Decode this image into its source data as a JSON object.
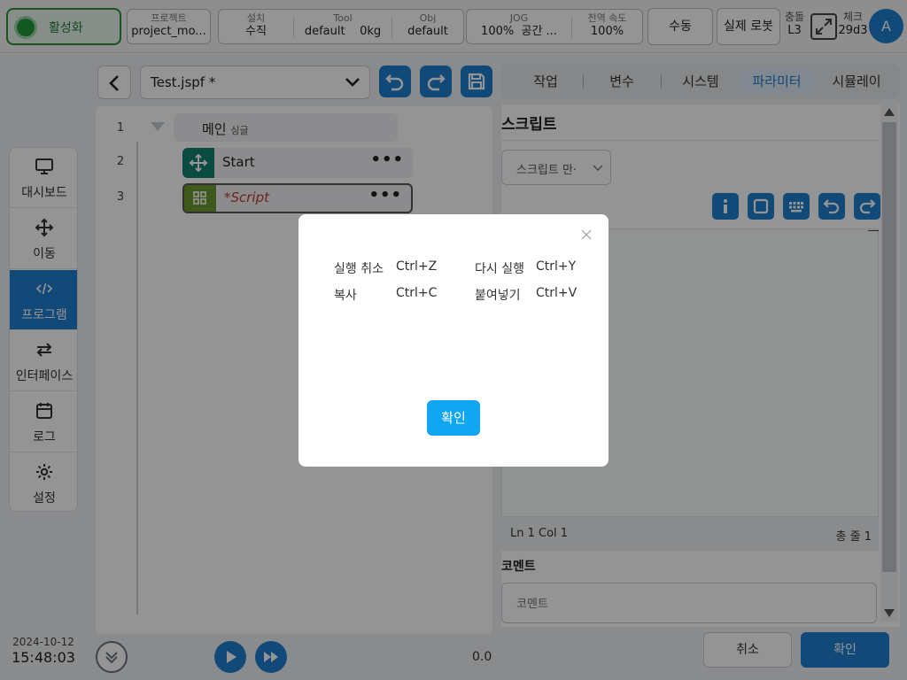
{
  "topbar": {
    "activate_label": "활성화",
    "project": {
      "caption": "프로젝트",
      "value": "project_mo..."
    },
    "install": {
      "caption": "설치",
      "value": "수직"
    },
    "tool": {
      "caption": "Tool",
      "value": "default",
      "weight": "0kg"
    },
    "obj": {
      "caption": "Obj",
      "value": "default"
    },
    "jog": {
      "caption": "JOG",
      "value": "100%",
      "space": "공간 ..."
    },
    "global_speed": {
      "caption": "전역 속도",
      "value": "100%"
    },
    "mode_label": "수동",
    "robot_label": "실제 로봇",
    "collision": {
      "caption": "충돌",
      "value": "L3"
    },
    "check": {
      "caption": "체크",
      "value": "29d3"
    },
    "avatar_letter": "A"
  },
  "nav": {
    "items": [
      {
        "label": "대시보드",
        "icon": "monitor-icon"
      },
      {
        "label": "이동",
        "icon": "move-icon"
      },
      {
        "label": "프로그램",
        "icon": "code-icon"
      },
      {
        "label": "인터페이스",
        "icon": "swap-icon"
      },
      {
        "label": "로그",
        "icon": "calendar-icon"
      },
      {
        "label": "설정",
        "icon": "gear-icon"
      }
    ],
    "active_index": 2
  },
  "datetime": {
    "date": "2024-10-12",
    "time": "15:48:03"
  },
  "editor": {
    "file_name": "Test.jspf *",
    "line_numbers": [
      "1",
      "2",
      "3"
    ],
    "main_label": "메인",
    "main_sub": "싱글",
    "nodes": [
      {
        "label": "Start",
        "icon": "move-icon",
        "color": "#14806e"
      },
      {
        "label": "*Script",
        "icon": "grid-icon",
        "color": "#6c9a2f"
      }
    ],
    "more": "•••",
    "speed_value": "0.0"
  },
  "tabs": [
    {
      "label": "작업"
    },
    {
      "label": "변수"
    },
    {
      "label": "시스템"
    },
    {
      "label": "파라미터"
    },
    {
      "label": "시뮬레이"
    }
  ],
  "active_tab": 3,
  "script_panel": {
    "title": "스크립트",
    "dropdown_value": "스크립트 만·",
    "status_left": "Ln 1 Col 1",
    "status_right": "총 줄 1",
    "comment_label": "코멘트",
    "comment_placeholder": "코멘트",
    "cancel_label": "취소",
    "ok_label": "확인"
  },
  "modal": {
    "shortcuts": [
      {
        "action": "실행 취소",
        "key": "Ctrl+Z"
      },
      {
        "action": "다시 실행",
        "key": "Ctrl+Y"
      },
      {
        "action": "복사",
        "key": "Ctrl+C"
      },
      {
        "action": "붙여넣기",
        "key": "Ctrl+V"
      }
    ],
    "ok_label": "확인"
  },
  "colors": {
    "accent": "#1e7fd0",
    "modal_button": "#11a6f2",
    "active_green": "#1f9a3a"
  }
}
